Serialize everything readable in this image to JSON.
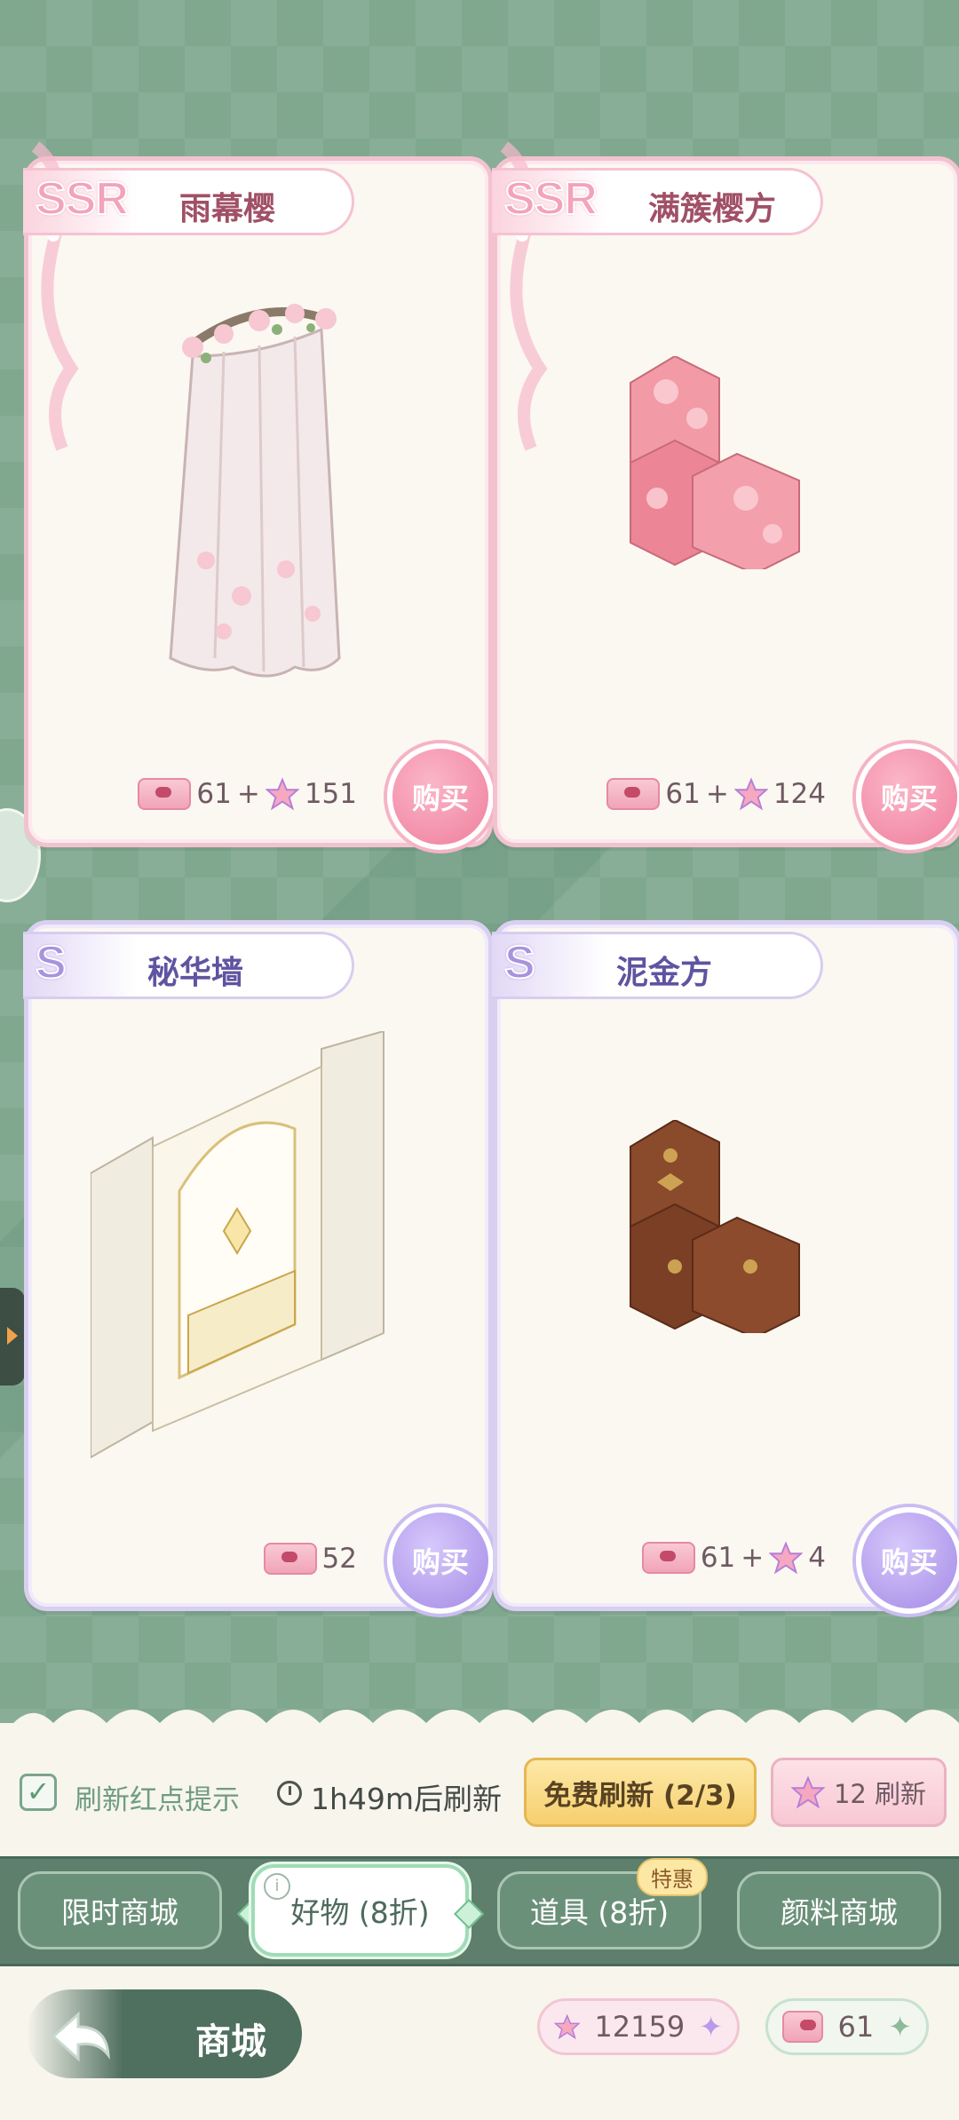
{
  "cards": [
    {
      "rarity": "SSR",
      "name": "雨幕樱",
      "coupon_cost": "61",
      "plus": "+",
      "star_cost": "151",
      "buy_label": "购买"
    },
    {
      "rarity": "SSR",
      "name": "满簇樱方",
      "coupon_cost": "61",
      "plus": "+",
      "star_cost": "124",
      "buy_label": "购买"
    },
    {
      "rarity": "S",
      "name": "秘华墙",
      "coupon_cost": "52",
      "buy_label": "购买"
    },
    {
      "rarity": "S",
      "name": "泥金方",
      "coupon_cost": "61",
      "plus": "+",
      "star_cost": "4",
      "buy_label": "购买"
    }
  ],
  "refresh": {
    "red_dot_label": "刷新红点提示",
    "checked": true,
    "timer": "1h49m后刷新",
    "free_label": "免费刷新 (2/3)",
    "paid_label": "12 刷新"
  },
  "tabs": [
    {
      "label": "限时商城"
    },
    {
      "label": "好物 (8折)",
      "active": true
    },
    {
      "label": "道具 (8折)",
      "badge": "特惠"
    },
    {
      "label": "颜料商城"
    }
  ],
  "nav": {
    "title": "商城",
    "stars_balance": "12159",
    "coupons_balance": "61"
  },
  "colors": {
    "ssr_accent": "#f3a3bb",
    "s_accent": "#a893de",
    "bg_green": "#7fa88f"
  },
  "icons": {
    "coupon": "ticket-icon",
    "star": "star-gem-icon",
    "back": "back-arrow-icon",
    "clock": "clock-icon"
  }
}
